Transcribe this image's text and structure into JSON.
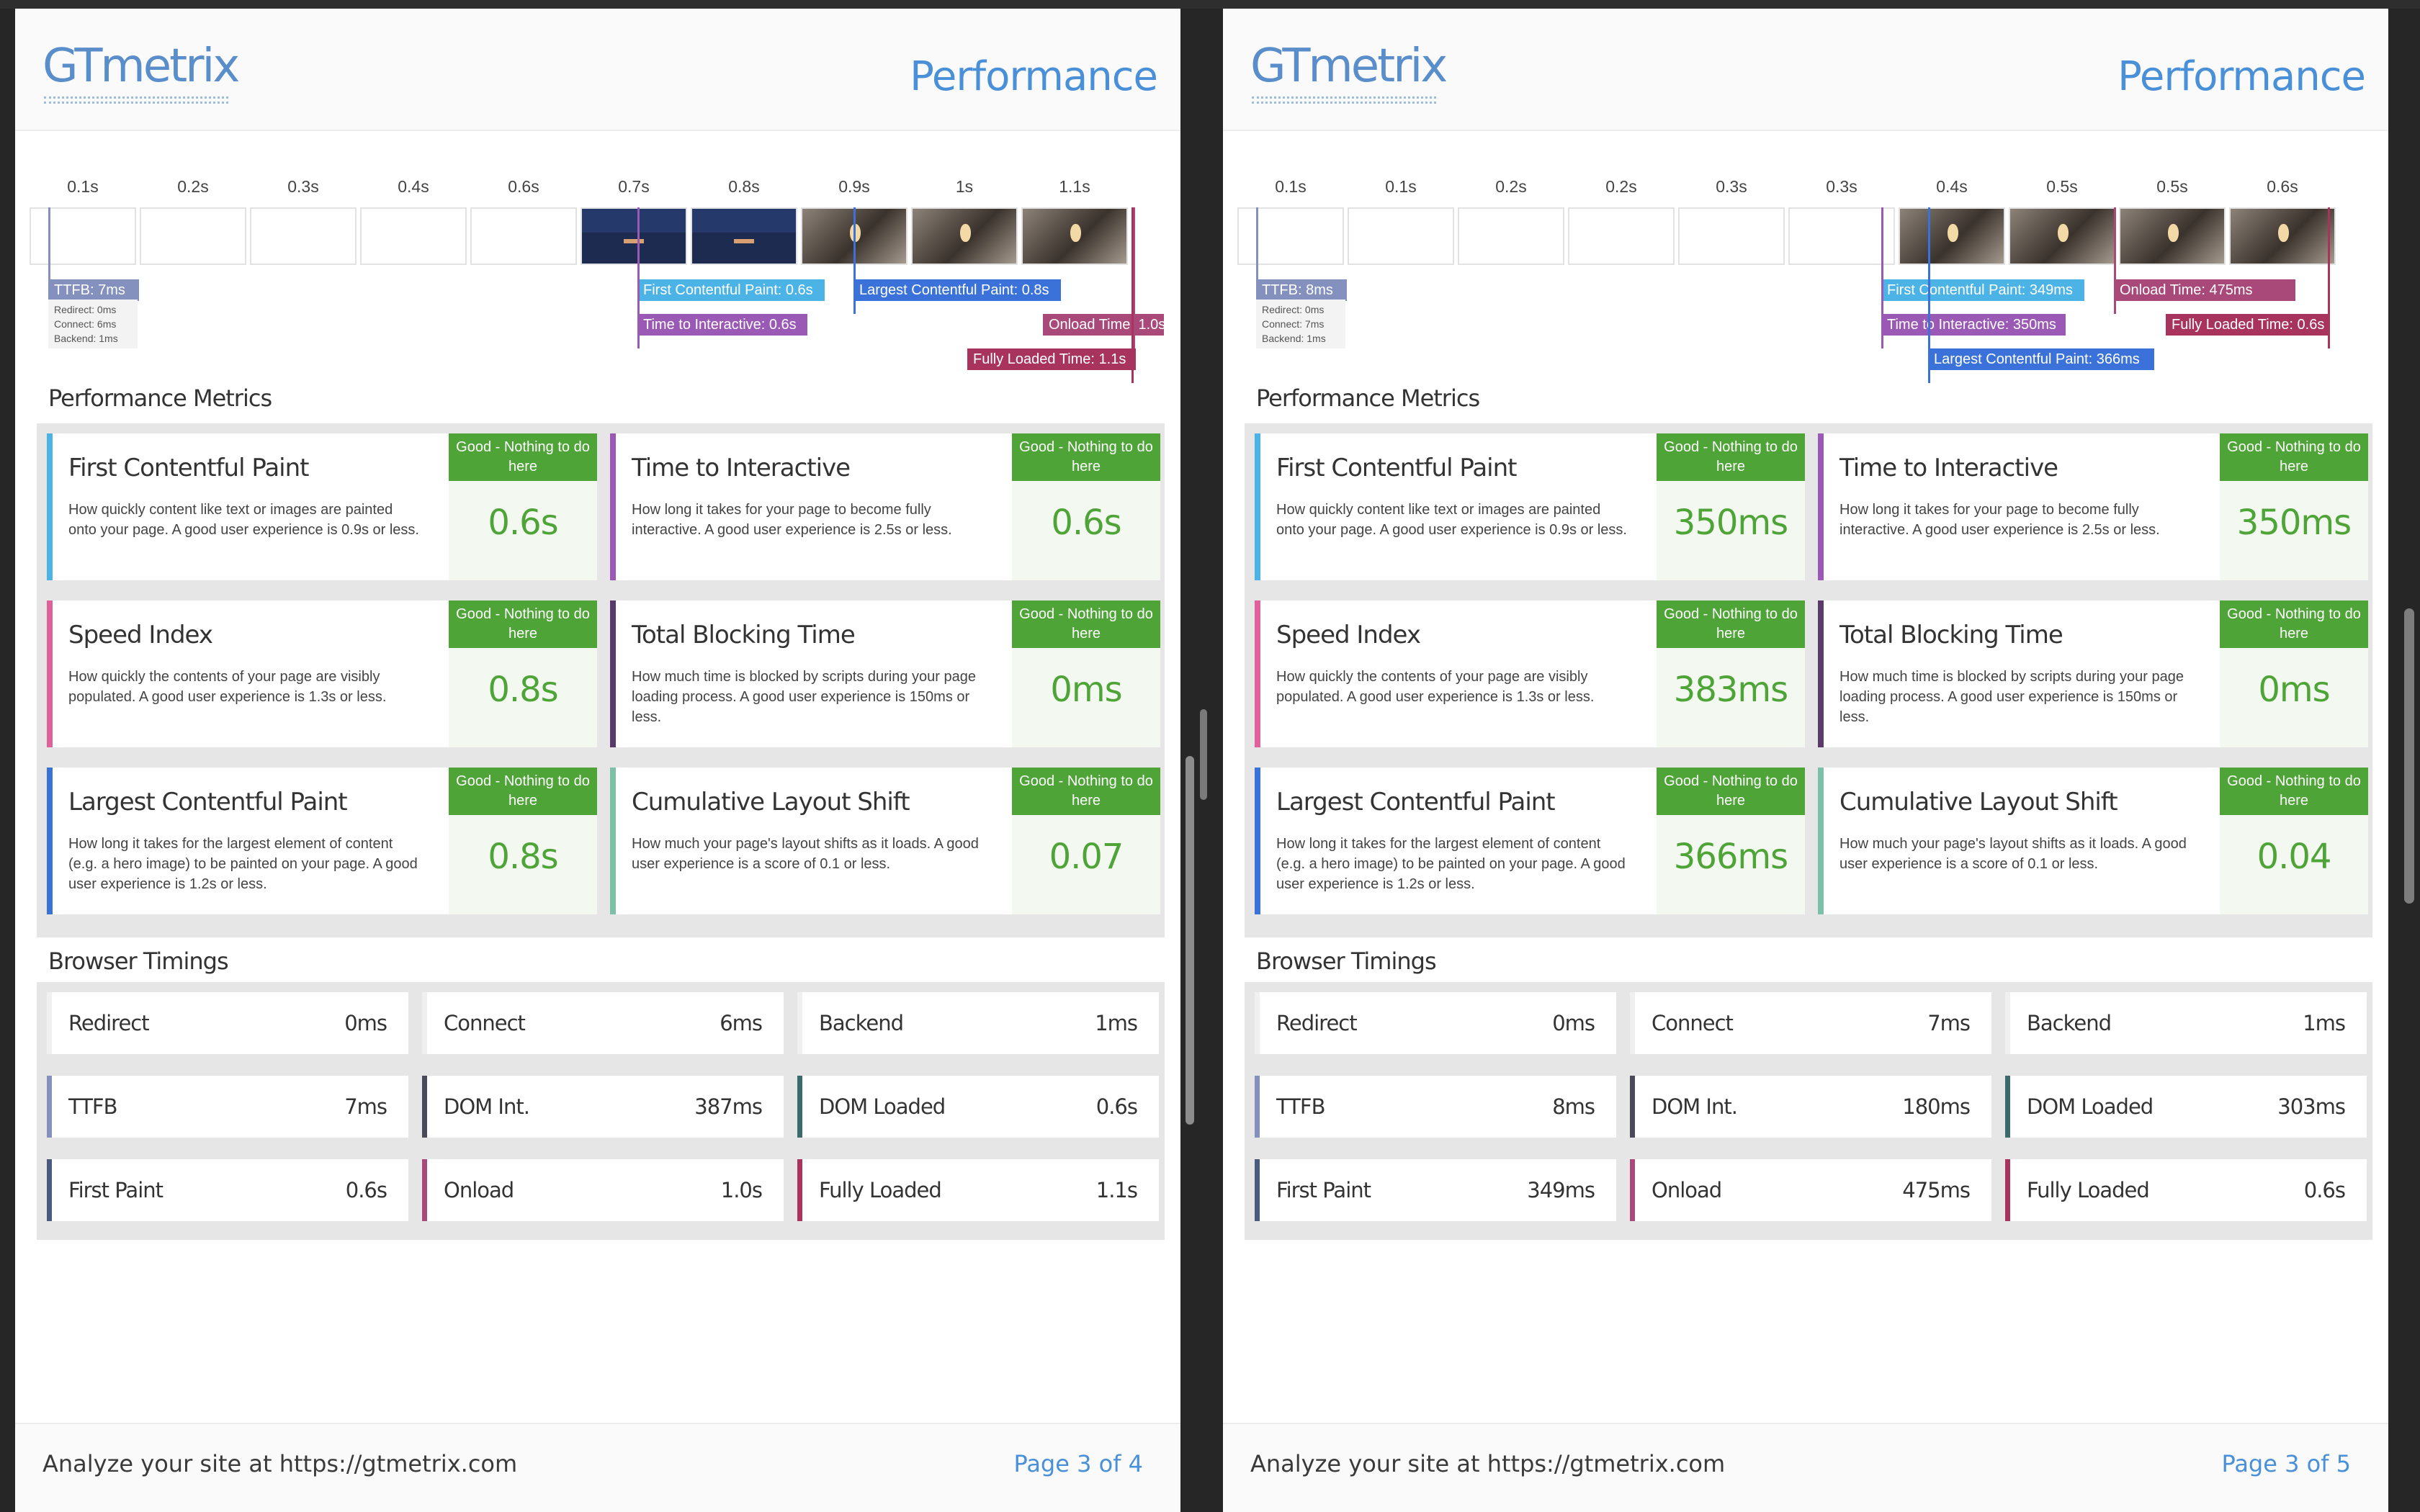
{
  "colors": {
    "brand_blue": "#4a90d9",
    "good_green": "#4ea437",
    "fcp": "#4bb3e6",
    "tti": "#9b59b6",
    "lcp": "#3b72d9",
    "onload": "#a8497a",
    "fully_loaded": "#a8345e",
    "ttfb": "#8491bf",
    "si": "#e0609a",
    "tbt": "#5a3a6a",
    "cls": "#7cc0a8"
  },
  "pages": [
    {
      "logo": "GTmetrix",
      "title": "Performance",
      "filmstrip": {
        "ticks": [
          "0.1s",
          "0.2s",
          "0.3s",
          "0.4s",
          "0.6s",
          "0.7s",
          "0.8s",
          "0.9s",
          "1s",
          "1.1s"
        ],
        "frames": [
          "blank",
          "blank",
          "blank",
          "blank",
          "blank",
          "shot",
          "shot",
          "ceil",
          "ceil",
          "ceil"
        ]
      },
      "ttfb_label": "TTFB: 7ms",
      "ttfb_details": [
        "Redirect: 0ms",
        "Connect: 6ms",
        "Backend: 1ms"
      ],
      "markers": [
        {
          "name": "fcp-marker",
          "label": "First Contentful Paint: 0.6s",
          "color": "#4bb3e6"
        },
        {
          "name": "lcp-marker",
          "label": "Largest Contentful Paint: 0.8s",
          "color": "#3b72d9"
        },
        {
          "name": "tti-marker",
          "label": "Time to Interactive: 0.6s",
          "color": "#9b59b6"
        },
        {
          "name": "onload-marker",
          "label": "Onload Time: 1.0s",
          "color": "#a8497a"
        },
        {
          "name": "fully-loaded-marker",
          "label": "Fully Loaded Time: 1.1s",
          "color": "#a8345e"
        }
      ],
      "perf_title": "Performance Metrics",
      "metrics": [
        {
          "name": "First Contentful Paint",
          "desc": "How quickly content like text or images are painted onto your page. A good user experience is 0.9s or less.",
          "grade": "Good - Nothing to do here",
          "value": "0.6s"
        },
        {
          "name": "Time to Interactive",
          "desc": "How long it takes for your page to become fully interactive. A good user experience is 2.5s or less.",
          "grade": "Good - Nothing to do here",
          "value": "0.6s"
        },
        {
          "name": "Speed Index",
          "desc": "How quickly the contents of your page are visibly populated. A good user experience is 1.3s or less.",
          "grade": "Good - Nothing to do here",
          "value": "0.8s"
        },
        {
          "name": "Total Blocking Time",
          "desc": "How much time is blocked by scripts during your page loading process. A good user experience is 150ms or less.",
          "grade": "Good - Nothing to do here",
          "value": "0ms"
        },
        {
          "name": "Largest Contentful Paint",
          "desc": "How long it takes for the largest element of content (e.g. a hero image) to be painted on your page. A good user experience is 1.2s or less.",
          "grade": "Good - Nothing to do here",
          "value": "0.8s"
        },
        {
          "name": "Cumulative Layout Shift",
          "desc": "How much your page's layout shifts as it loads. A good user experience is a score of 0.1 or less.",
          "grade": "Good - Nothing to do here",
          "value": "0.07"
        }
      ],
      "browser_title": "Browser Timings",
      "timings": [
        {
          "label": "Redirect",
          "value": "0ms"
        },
        {
          "label": "Connect",
          "value": "6ms"
        },
        {
          "label": "Backend",
          "value": "1ms"
        },
        {
          "label": "TTFB",
          "value": "7ms"
        },
        {
          "label": "DOM Int.",
          "value": "387ms"
        },
        {
          "label": "DOM Loaded",
          "value": "0.6s"
        },
        {
          "label": "First Paint",
          "value": "0.6s"
        },
        {
          "label": "Onload",
          "value": "1.0s"
        },
        {
          "label": "Fully Loaded",
          "value": "1.1s"
        }
      ],
      "footer_left": "Analyze your site at https://gtmetrix.com",
      "footer_right": "Page 3 of 4"
    },
    {
      "logo": "GTmetrix",
      "title": "Performance",
      "filmstrip": {
        "ticks": [
          "0.1s",
          "0.1s",
          "0.2s",
          "0.2s",
          "0.3s",
          "0.3s",
          "0.4s",
          "0.5s",
          "0.5s",
          "0.6s"
        ],
        "frames": [
          "blank",
          "blank",
          "blank",
          "blank",
          "blank",
          "blank",
          "ceil",
          "ceil",
          "ceil",
          "ceil"
        ]
      },
      "ttfb_label": "TTFB: 8ms",
      "ttfb_details": [
        "Redirect: 0ms",
        "Connect: 7ms",
        "Backend: 1ms"
      ],
      "markers": [
        {
          "name": "fcp-marker",
          "label": "First Contentful Paint: 349ms",
          "color": "#4bb3e6"
        },
        {
          "name": "onload-marker",
          "label": "Onload Time: 475ms",
          "color": "#a8497a"
        },
        {
          "name": "tti-marker",
          "label": "Time to Interactive: 350ms",
          "color": "#9b59b6"
        },
        {
          "name": "fully-loaded-marker",
          "label": "Fully Loaded Time: 0.6s",
          "color": "#a8345e"
        },
        {
          "name": "lcp-marker",
          "label": "Largest Contentful Paint: 366ms",
          "color": "#3b72d9"
        }
      ],
      "perf_title": "Performance Metrics",
      "metrics": [
        {
          "name": "First Contentful Paint",
          "desc": "How quickly content like text or images are painted onto your page. A good user experience is 0.9s or less.",
          "grade": "Good - Nothing to do here",
          "value": "350ms"
        },
        {
          "name": "Time to Interactive",
          "desc": "How long it takes for your page to become fully interactive. A good user experience is 2.5s or less.",
          "grade": "Good - Nothing to do here",
          "value": "350ms"
        },
        {
          "name": "Speed Index",
          "desc": "How quickly the contents of your page are visibly populated. A good user experience is 1.3s or less.",
          "grade": "Good - Nothing to do here",
          "value": "383ms"
        },
        {
          "name": "Total Blocking Time",
          "desc": "How much time is blocked by scripts during your page loading process. A good user experience is 150ms or less.",
          "grade": "Good - Nothing to do here",
          "value": "0ms"
        },
        {
          "name": "Largest Contentful Paint",
          "desc": "How long it takes for the largest element of content (e.g. a hero image) to be painted on your page. A good user experience is 1.2s or less.",
          "grade": "Good - Nothing to do here",
          "value": "366ms"
        },
        {
          "name": "Cumulative Layout Shift",
          "desc": "How much your page's layout shifts as it loads. A good user experience is a score of 0.1 or less.",
          "grade": "Good - Nothing to do here",
          "value": "0.04"
        }
      ],
      "browser_title": "Browser Timings",
      "timings": [
        {
          "label": "Redirect",
          "value": "0ms"
        },
        {
          "label": "Connect",
          "value": "7ms"
        },
        {
          "label": "Backend",
          "value": "1ms"
        },
        {
          "label": "TTFB",
          "value": "8ms"
        },
        {
          "label": "DOM Int.",
          "value": "180ms"
        },
        {
          "label": "DOM Loaded",
          "value": "303ms"
        },
        {
          "label": "First Paint",
          "value": "349ms"
        },
        {
          "label": "Onload",
          "value": "475ms"
        },
        {
          "label": "Fully Loaded",
          "value": "0.6s"
        }
      ],
      "footer_left": "Analyze your site at https://gtmetrix.com",
      "footer_right": "Page 3 of 5"
    }
  ]
}
